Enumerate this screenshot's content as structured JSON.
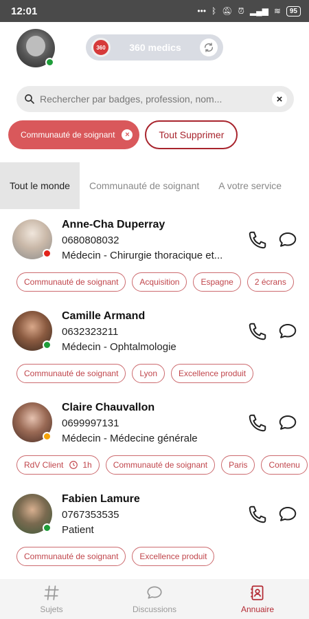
{
  "status_bar": {
    "time": "12:01",
    "battery": "95"
  },
  "header": {
    "org_name": "360 medics",
    "org_logo_text": "360"
  },
  "search": {
    "placeholder": "Rechercher par badges, profession, nom..."
  },
  "filters": {
    "active_filter": "Communauté de soignant",
    "clear_all_label": "Tout Supprimer"
  },
  "tabs": [
    {
      "label": "Tout le monde",
      "active": true
    },
    {
      "label": "Communauté de soignant",
      "active": false
    },
    {
      "label": "A votre service",
      "active": false
    }
  ],
  "contacts": [
    {
      "name": "Anne-Cha Duperray",
      "phone": "0680808032",
      "role": "Médecin - Chirurgie thoracique et...",
      "presence": "red",
      "tags": [
        "Communauté de soignant",
        "Acquisition",
        "Espagne",
        "2 écrans"
      ]
    },
    {
      "name": "Camille Armand",
      "phone": "0632323211",
      "role": "Médecin - Ophtalmologie",
      "presence": "green",
      "tags": [
        "Communauté de soignant",
        "Lyon",
        "Excellence produit"
      ]
    },
    {
      "name": "Claire Chauvallon",
      "phone": "0699997131",
      "role": "Médecin - Médecine générale",
      "presence": "orange",
      "rdv_tag": {
        "label": "RdV Client",
        "duration": "1h"
      },
      "tags": [
        "Communauté de soignant",
        "Paris",
        "Contenu"
      ]
    },
    {
      "name": "Fabien Lamure",
      "phone": "0767353535",
      "role": "Patient",
      "presence": "green",
      "tags": [
        "Communauté de soignant",
        "Excellence produit"
      ]
    }
  ],
  "nav": [
    {
      "label": "Sujets",
      "icon": "hash-icon",
      "active": false
    },
    {
      "label": "Discussions",
      "icon": "chat-bubble-icon",
      "active": false
    },
    {
      "label": "Annuaire",
      "icon": "contacts-book-icon",
      "active": true
    }
  ],
  "colors": {
    "accent": "#d9585b",
    "accent_dark": "#a8242d",
    "online": "#1f9d3a",
    "busy": "#e2231a",
    "away": "#f5a30a"
  }
}
